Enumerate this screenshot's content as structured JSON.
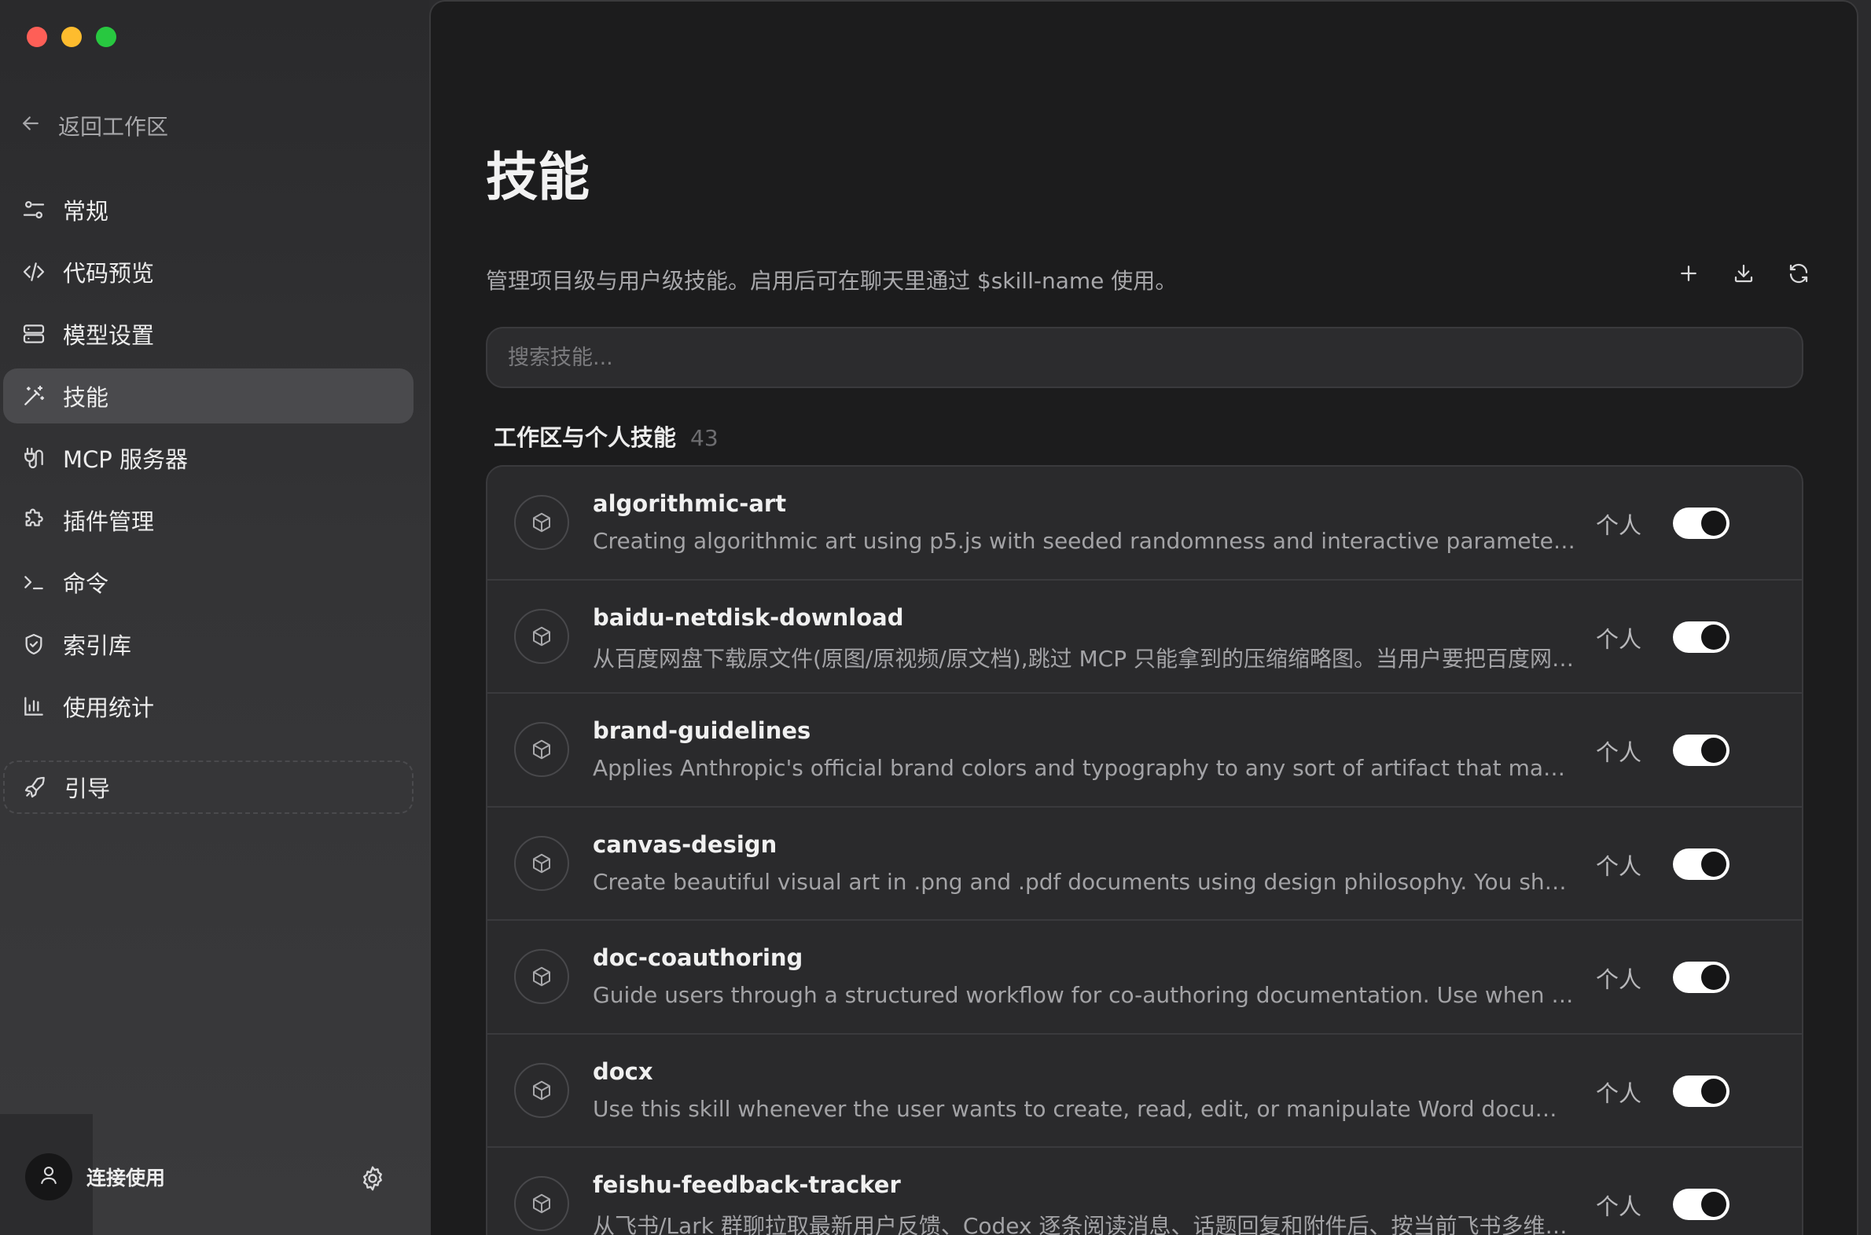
{
  "window": {
    "traffic_colors": {
      "close": "#fe5f57",
      "minimize": "#febc2e",
      "maximize": "#28c840"
    }
  },
  "sidebar": {
    "back_label": "返回工作区",
    "items": [
      {
        "label": "常规",
        "icon": "sliders-icon"
      },
      {
        "label": "代码预览",
        "icon": "code-icon"
      },
      {
        "label": "模型设置",
        "icon": "server-icon"
      },
      {
        "label": "技能",
        "icon": "magic-wand-icon",
        "active": true
      },
      {
        "label": "MCP 服务器",
        "icon": "plug-icon"
      },
      {
        "label": "插件管理",
        "icon": "puzzle-icon"
      },
      {
        "label": "命令",
        "icon": "terminal-icon"
      },
      {
        "label": "索引库",
        "icon": "shield-icon"
      },
      {
        "label": "使用统计",
        "icon": "bar-chart-icon"
      }
    ],
    "guide_label": "引导",
    "user_label": "连接使用"
  },
  "main": {
    "title": "技能",
    "subtitle": "管理项目级与用户级技能。启用后可在聊天里通过 $skill-name 使用。",
    "search_placeholder": "搜索技能...",
    "section_title": "工作区与个人技能",
    "section_count": "43",
    "skills": [
      {
        "name": "algorithmic-art",
        "desc": "Creating algorithmic art using p5.js with seeded randomness and interactive parameter exploratio...",
        "scope": "个人",
        "enabled": true
      },
      {
        "name": "baidu-netdisk-download",
        "desc": "从百度网盘下载原文件(原图/原视频/原文档),跳过 MCP 只能拿到的压缩缩略图。当用户要把百度网盘里...",
        "scope": "个人",
        "enabled": true
      },
      {
        "name": "brand-guidelines",
        "desc": "Applies Anthropic's official brand colors and typography to any sort of artifact that may benefit fro...",
        "scope": "个人",
        "enabled": true
      },
      {
        "name": "canvas-design",
        "desc": "Create beautiful visual art in .png and .pdf documents using design philosophy. You should use thi...",
        "scope": "个人",
        "enabled": true
      },
      {
        "name": "doc-coauthoring",
        "desc": "Guide users through a structured workflow for co-authoring documentation. Use when user wants...",
        "scope": "个人",
        "enabled": true
      },
      {
        "name": "docx",
        "desc": "Use this skill whenever the user wants to create, read, edit, or manipulate Word documents (.docx ...",
        "scope": "个人",
        "enabled": true
      },
      {
        "name": "feishu-feedback-tracker",
        "desc": "从飞书/Lark 群聊拉取最新用户反馈、Codex 逐条阅读消息、话题回复和附件后、按当前飞书多维表格...",
        "scope": "个人",
        "enabled": true
      }
    ]
  }
}
